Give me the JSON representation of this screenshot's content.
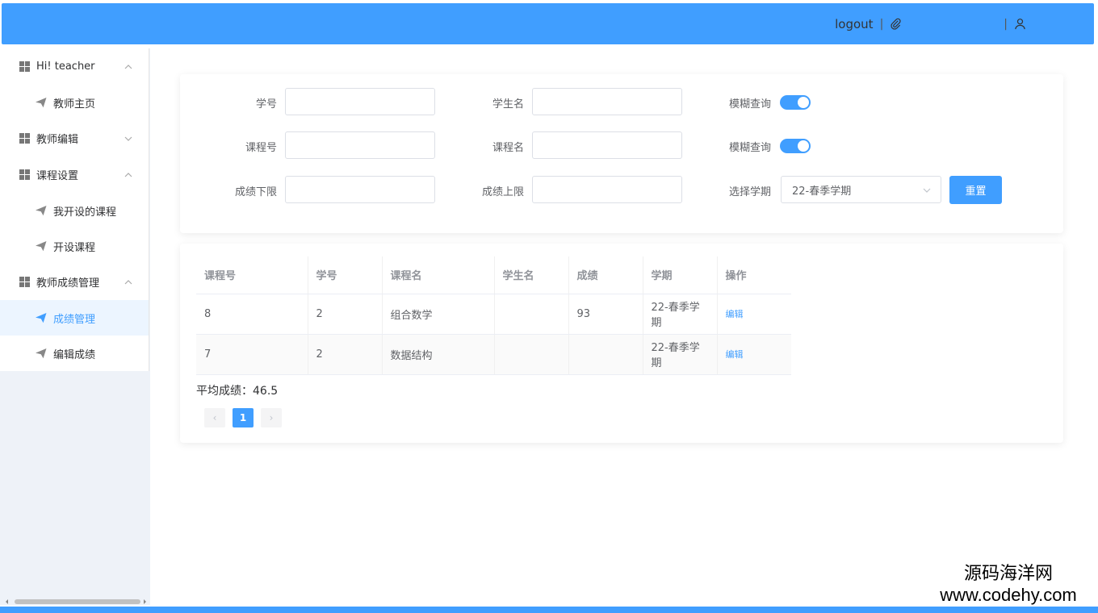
{
  "header": {
    "logout_label": "logout"
  },
  "sidebar": {
    "items": [
      {
        "label": "Hi! teacher"
      },
      {
        "label": "教师主页"
      },
      {
        "label": "教师编辑"
      },
      {
        "label": "课程设置"
      },
      {
        "label": "我开设的课程"
      },
      {
        "label": "开设课程"
      },
      {
        "label": "教师成绩管理"
      },
      {
        "label": "成绩管理"
      },
      {
        "label": "编辑成绩"
      }
    ]
  },
  "filters": {
    "student_id_label": "学号",
    "student_name_label": "学生名",
    "fuzzy_label_1": "模糊查询",
    "course_id_label": "课程号",
    "course_name_label": "课程名",
    "fuzzy_label_2": "模糊查询",
    "score_min_label": "成绩下限",
    "score_max_label": "成绩上限",
    "term_label": "选择学期",
    "term_value": "22-春季学期",
    "reset_label": "重置"
  },
  "table": {
    "headers": [
      "课程号",
      "学号",
      "课程名",
      "学生名",
      "成绩",
      "学期",
      "操作"
    ],
    "rows": [
      {
        "course_id": "8",
        "student_id": "2",
        "course_name": "组合数学",
        "student_name": "",
        "score": "93",
        "term": "22-春季学期",
        "action": "编辑"
      },
      {
        "course_id": "7",
        "student_id": "2",
        "course_name": "数据结构",
        "student_name": "",
        "score": "",
        "term": "22-春季学期",
        "action": "编辑"
      }
    ]
  },
  "summary": {
    "average_text": "平均成绩：46.5"
  },
  "pagination": {
    "current": "1",
    "prev": "‹",
    "next": "›"
  },
  "watermark": {
    "line1": "源码海洋网",
    "line2": "www.codehy.com"
  },
  "colors": {
    "primary": "#409eff"
  }
}
